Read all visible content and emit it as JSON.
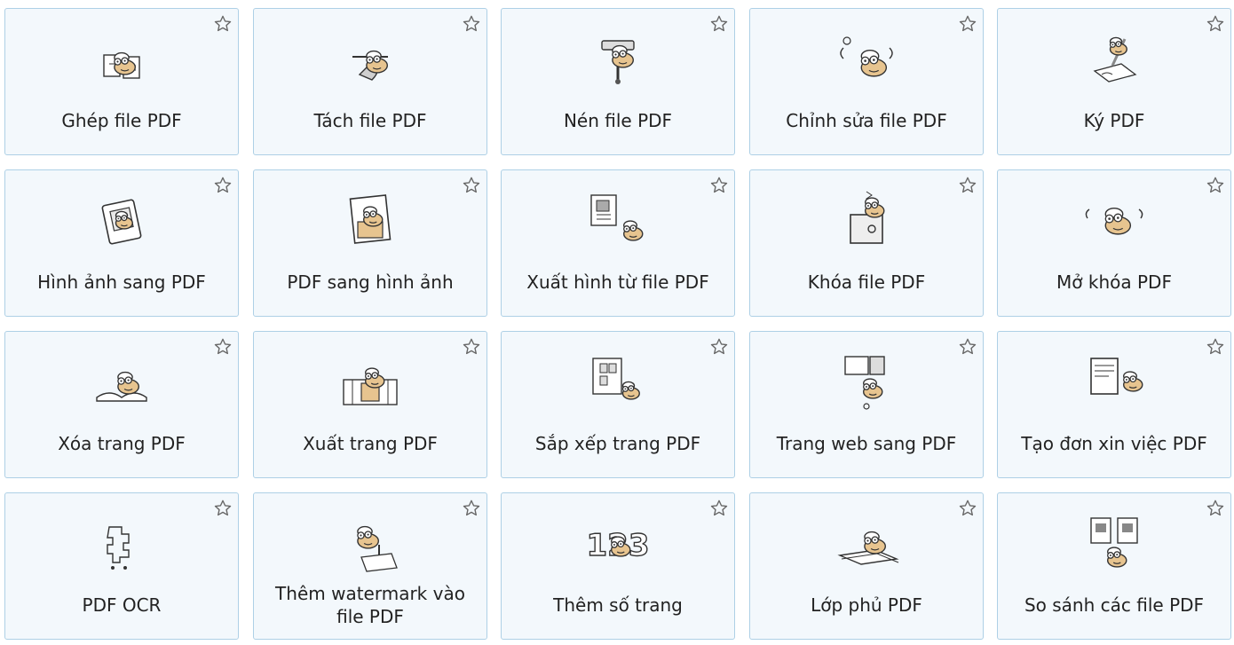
{
  "tools": [
    {
      "label": "Ghép file PDF",
      "icon": "merge-pdf-icon"
    },
    {
      "label": "Tách file PDF",
      "icon": "split-pdf-icon"
    },
    {
      "label": "Nén file PDF",
      "icon": "compress-pdf-icon"
    },
    {
      "label": "Chỉnh sửa file PDF",
      "icon": "edit-pdf-icon"
    },
    {
      "label": "Ký PDF",
      "icon": "sign-pdf-icon"
    },
    {
      "label": "Hình ảnh sang PDF",
      "icon": "image-to-pdf-icon"
    },
    {
      "label": "PDF sang hình ảnh",
      "icon": "pdf-to-image-icon"
    },
    {
      "label": "Xuất hình từ file PDF",
      "icon": "extract-images-icon"
    },
    {
      "label": "Khóa file PDF",
      "icon": "lock-pdf-icon"
    },
    {
      "label": "Mở khóa PDF",
      "icon": "unlock-pdf-icon"
    },
    {
      "label": "Xóa trang PDF",
      "icon": "delete-pages-icon"
    },
    {
      "label": "Xuất trang PDF",
      "icon": "extract-pages-icon"
    },
    {
      "label": "Sắp xếp trang PDF",
      "icon": "rearrange-pages-icon"
    },
    {
      "label": "Trang web sang PDF",
      "icon": "webpage-to-pdf-icon"
    },
    {
      "label": "Tạo đơn xin việc PDF",
      "icon": "create-resume-icon"
    },
    {
      "label": "PDF OCR",
      "icon": "pdf-ocr-icon"
    },
    {
      "label": "Thêm watermark vào file PDF",
      "icon": "add-watermark-icon"
    },
    {
      "label": "Thêm số trang",
      "icon": "add-page-numbers-icon"
    },
    {
      "label": "Lớp phủ PDF",
      "icon": "overlay-pdf-icon"
    },
    {
      "label": "So sánh các file PDF",
      "icon": "compare-pdf-icon"
    }
  ],
  "colors": {
    "card_background": "#f3f8fc",
    "card_border": "#aed0e6",
    "star_outline": "#666666",
    "mascot_skin": "#e7c48f",
    "line": "#333333"
  }
}
